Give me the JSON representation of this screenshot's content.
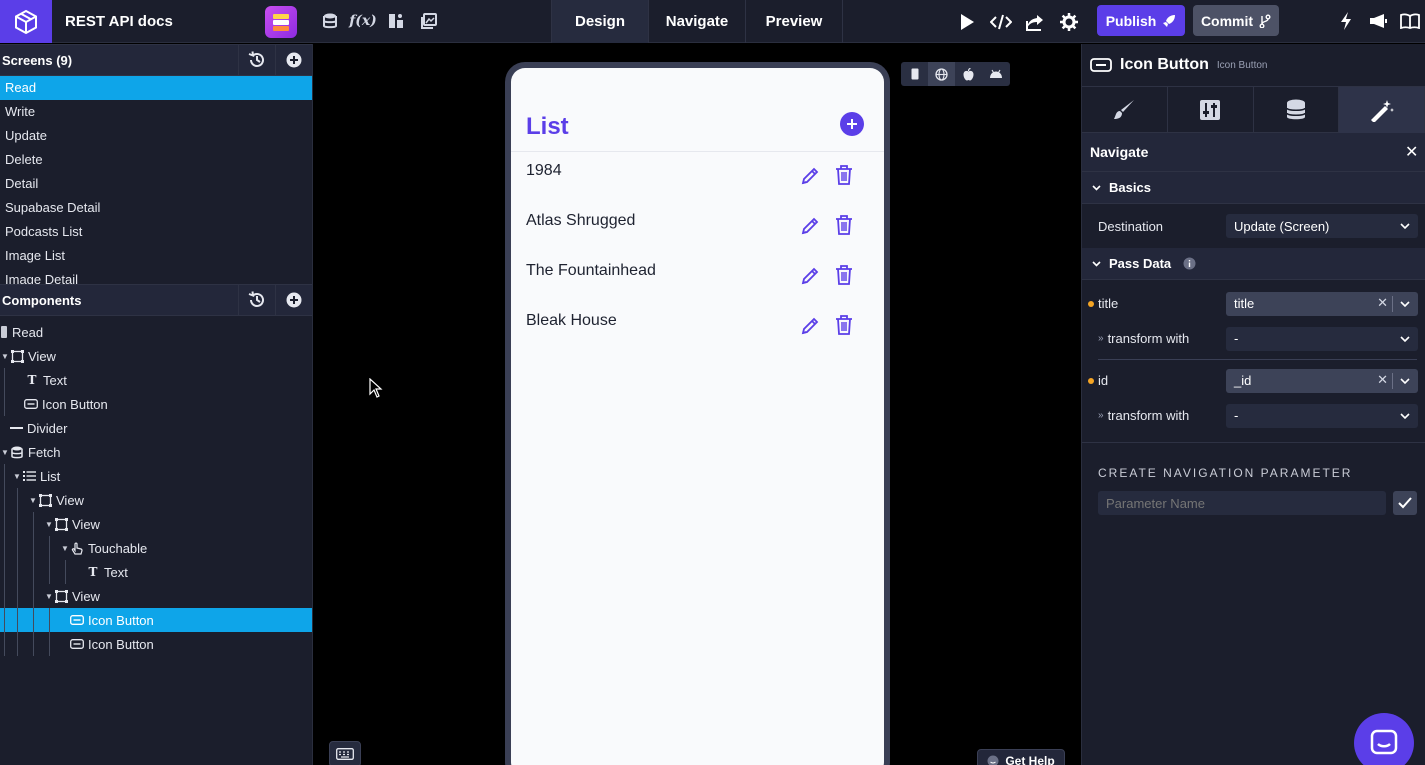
{
  "topbar": {
    "project_title": "REST API docs",
    "modes": [
      {
        "label": "Design",
        "active": true
      },
      {
        "label": "Navigate",
        "active": false
      },
      {
        "label": "Preview",
        "active": false
      }
    ],
    "publish_label": "Publish",
    "commit_label": "Commit"
  },
  "screens": {
    "header": "Screens (9)",
    "items": [
      {
        "label": "Read",
        "active": true
      },
      {
        "label": "Write",
        "active": false
      },
      {
        "label": "Update",
        "active": false
      },
      {
        "label": "Delete",
        "active": false
      },
      {
        "label": "Detail",
        "active": false
      },
      {
        "label": "Supabase Detail",
        "active": false
      },
      {
        "label": "Podcasts List",
        "active": false
      },
      {
        "label": "Image List",
        "active": false
      },
      {
        "label": "Image Detail",
        "active": false
      }
    ]
  },
  "components": {
    "header": "Components",
    "tree": [
      {
        "label": "Read",
        "icon": "screen-icon"
      },
      {
        "label": "View",
        "icon": "view-icon"
      },
      {
        "label": "Text",
        "icon": "text-icon"
      },
      {
        "label": "Icon Button",
        "icon": "icon-button-icon"
      },
      {
        "label": "Divider",
        "icon": "divider-icon"
      },
      {
        "label": "Fetch",
        "icon": "database-icon"
      },
      {
        "label": "List",
        "icon": "list-icon"
      },
      {
        "label": "View",
        "icon": "view-icon"
      },
      {
        "label": "View",
        "icon": "view-icon"
      },
      {
        "label": "Touchable",
        "icon": "touch-icon"
      },
      {
        "label": "Text",
        "icon": "text-icon"
      },
      {
        "label": "View",
        "icon": "view-icon"
      },
      {
        "label": "Icon Button",
        "icon": "icon-button-icon",
        "active": true
      },
      {
        "label": "Icon Button",
        "icon": "icon-button-icon"
      }
    ]
  },
  "phone": {
    "list_title": "List",
    "books": [
      "1984",
      "Atlas Shrugged",
      "The Fountainhead",
      "Bleak House"
    ]
  },
  "canvas": {
    "get_help_label": "Get Help"
  },
  "properties": {
    "component_name": "Icon Button",
    "component_type": "Icon Button",
    "panel_title": "Navigate",
    "basics_label": "Basics",
    "destination_label": "Destination",
    "destination_value": "Update (Screen)",
    "pass_data_label": "Pass Data",
    "params": [
      {
        "name": "title",
        "value": "title",
        "transform_label": "transform with",
        "transform_value": "-"
      },
      {
        "name": "id",
        "value": "_id",
        "transform_label": "transform with",
        "transform_value": "-"
      }
    ],
    "create_param_label": "CREATE NAVIGATION PARAMETER",
    "param_name_placeholder": "Parameter Name"
  },
  "colors": {
    "accent": "#5b3ee8",
    "selection": "#0ea5e9",
    "panel_bg": "#1b1e2c",
    "required_dot": "#f5a524"
  }
}
